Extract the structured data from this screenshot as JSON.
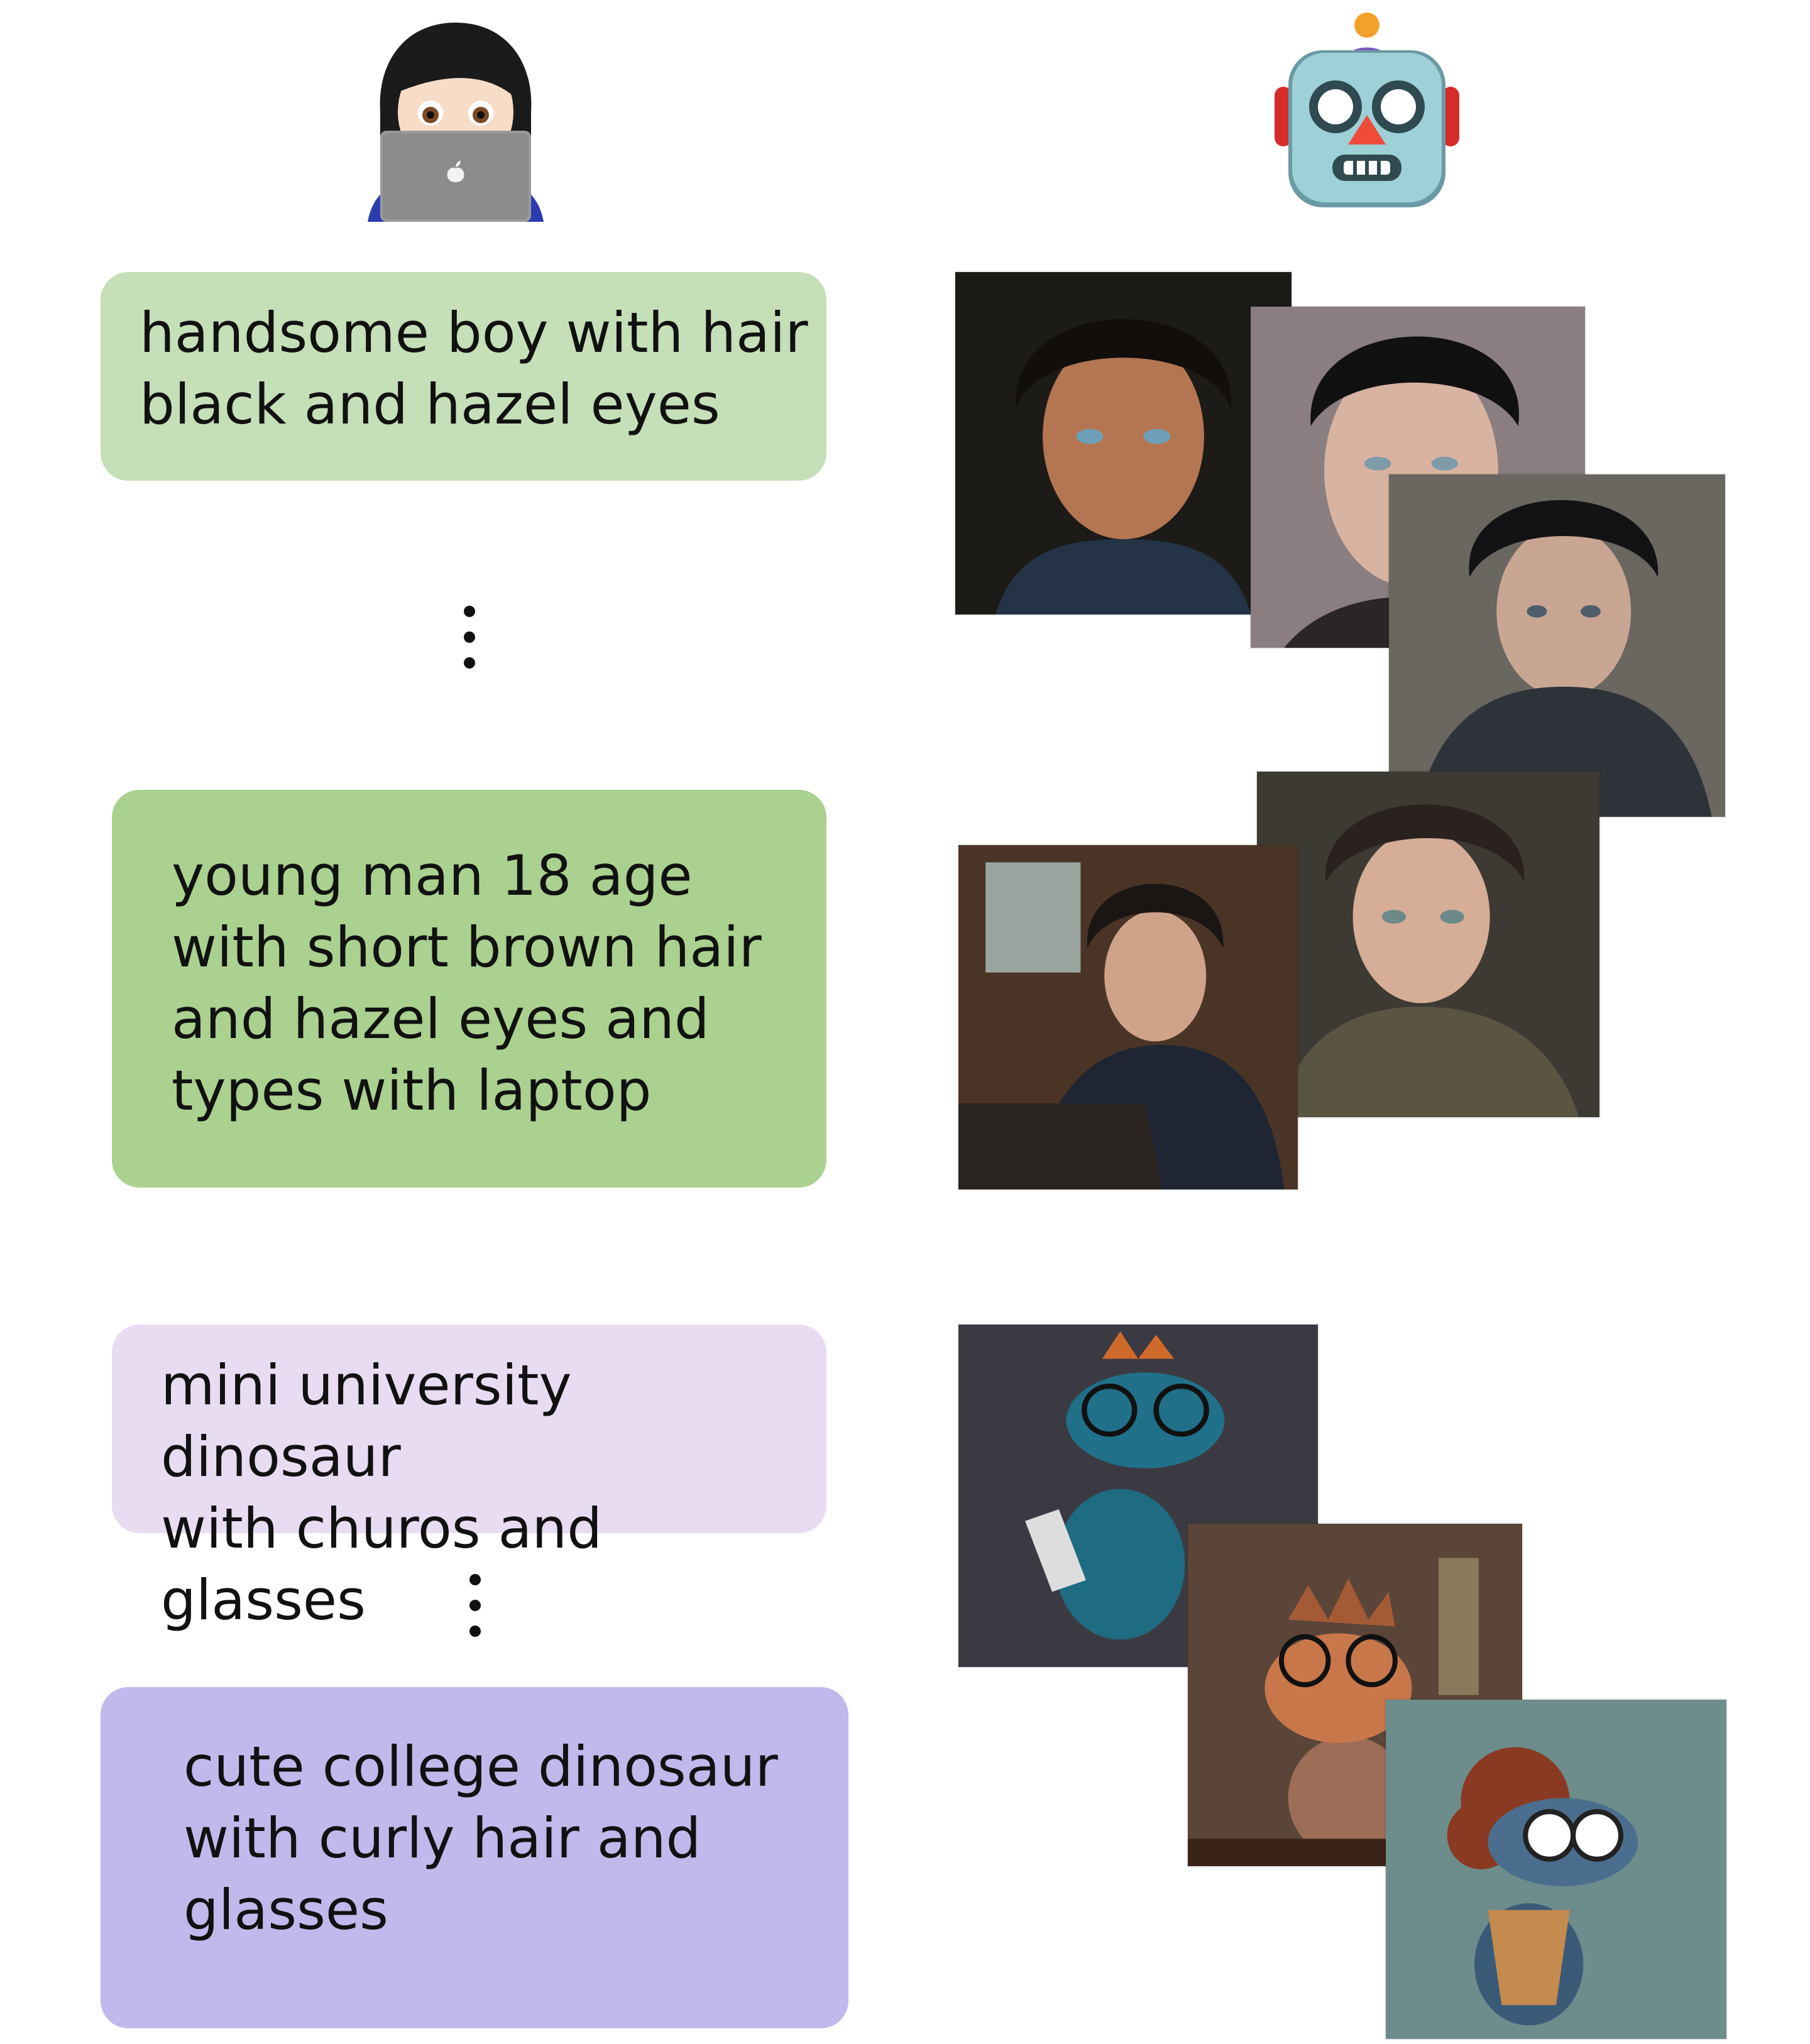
{
  "header": {
    "user_icon": "woman-technologist-icon",
    "model_icon": "robot-icon"
  },
  "prompts": [
    {
      "text": "handsome boy with hair\nblack and hazel eyes",
      "color": "#c5dfb8"
    },
    {
      "text": "young man 18 age\nwith short brown hair\nand hazel eyes and\ntypes with laptop",
      "color": "#aad18f"
    },
    {
      "text": "mini university dinosaur\nwith churos and glasses",
      "color": "#e8dcf3"
    },
    {
      "text": "cute college dinosaur\nwith curly hair and\nglasses",
      "color": "#c3b8ec"
    }
  ],
  "ellipsis_icon": "vertical-ellipsis-icon",
  "image_groups": [
    {
      "subject": "portrait-boy-images",
      "count": 3
    },
    {
      "subject": "portrait-young-man-laptop-images",
      "count": 2
    },
    {
      "subject": "dinosaur-churros-glasses-images",
      "count": 1
    },
    {
      "subject": "dinosaur-curly-hair-glasses-images",
      "count": 2
    }
  ]
}
